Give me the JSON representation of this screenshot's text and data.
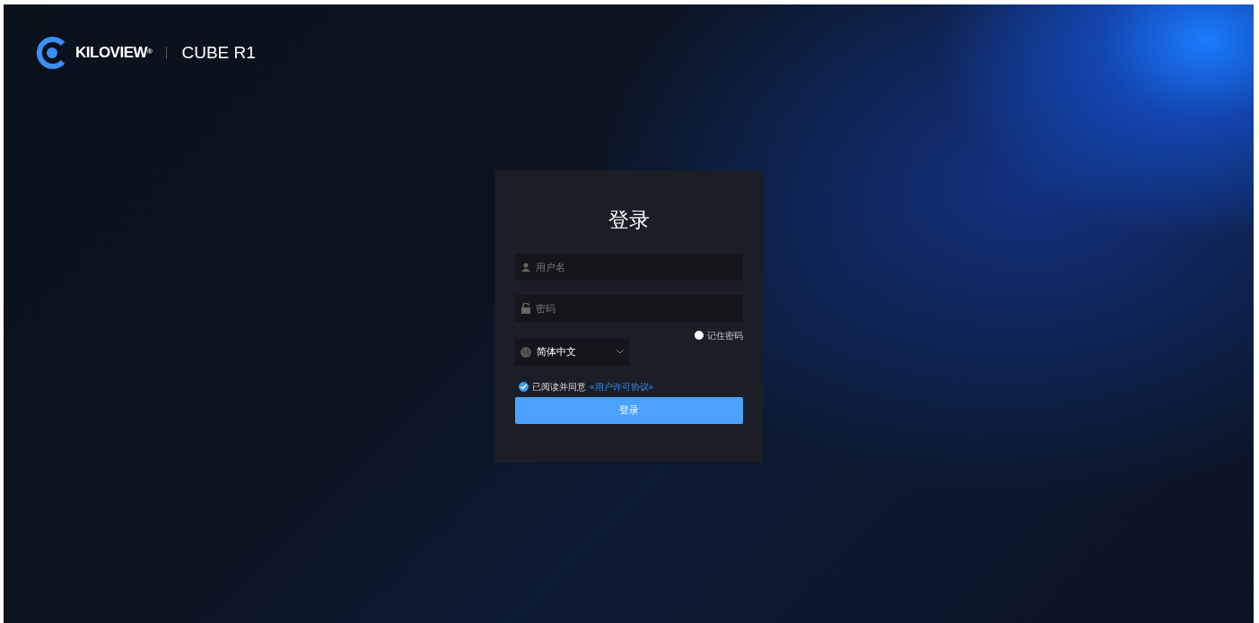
{
  "header": {
    "brand": "KILOVIEW$^{®}$",
    "product": "CUBE R1"
  },
  "login": {
    "title": "登录",
    "username": {
      "placeholder": "用户名"
    },
    "password": {
      "placeholder": "密码"
    },
    "remember": {
      "label": "记住密码",
      "checked": false
    },
    "language": {
      "value": "简体中文"
    },
    "agreement": {
      "text": "已阅读并同意",
      "link": "«用户许可协议»",
      "checked": true
    },
    "submit": "登录"
  }
}
